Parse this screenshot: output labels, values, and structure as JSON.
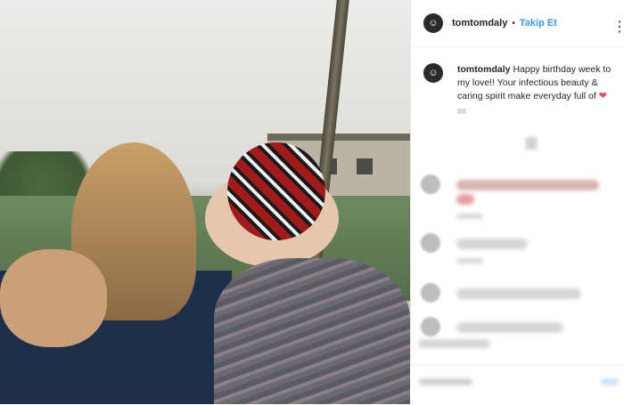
{
  "post": {
    "username": "tomtomdaly",
    "follow_label": "Takip Et",
    "more_icon": "more-icon",
    "caption_text": "Happy birthday week to my love!! Your infectious beauty & caring spirit make everyday full of",
    "heart_icon": "heart-icon",
    "heart_glyph": "❤"
  },
  "comments": [
    {
      "avatar_icon": "avatar-icon"
    },
    {
      "avatar_icon": "avatar-icon"
    },
    {
      "avatar_icon": "avatar-icon"
    },
    {
      "avatar_icon": "avatar-icon"
    }
  ],
  "colors": {
    "follow_blue": "#3897f0",
    "heart_red": "#ed4956"
  }
}
